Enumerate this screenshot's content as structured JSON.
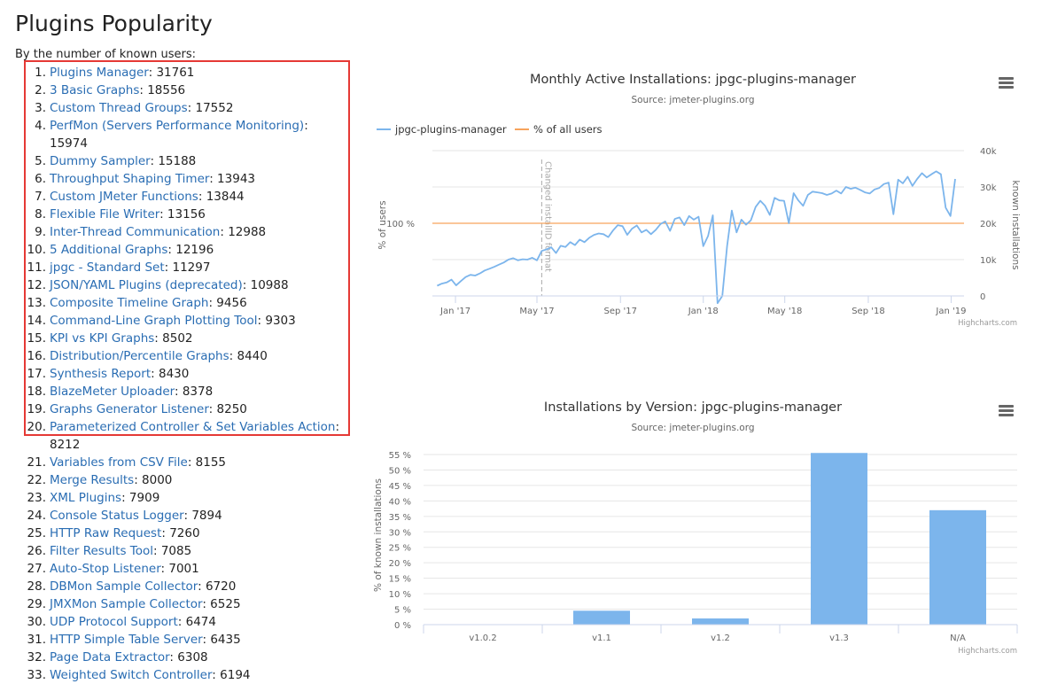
{
  "page": {
    "title": "Plugins Popularity",
    "subtitle": "By the number of known users:"
  },
  "plugins": [
    {
      "rank": "1.",
      "name": "Plugins Manager",
      "users": "31761"
    },
    {
      "rank": "2.",
      "name": "3 Basic Graphs",
      "users": "18556"
    },
    {
      "rank": "3.",
      "name": "Custom Thread Groups",
      "users": "17552"
    },
    {
      "rank": "4.",
      "name": "PerfMon (Servers Performance Monitoring)",
      "users": "15974"
    },
    {
      "rank": "5.",
      "name": "Dummy Sampler",
      "users": "15188"
    },
    {
      "rank": "6.",
      "name": "Throughput Shaping Timer",
      "users": "13943"
    },
    {
      "rank": "7.",
      "name": "Custom JMeter Functions",
      "users": "13844"
    },
    {
      "rank": "8.",
      "name": "Flexible File Writer",
      "users": "13156"
    },
    {
      "rank": "9.",
      "name": "Inter-Thread Communication",
      "users": "12988"
    },
    {
      "rank": "10.",
      "name": "5 Additional Graphs",
      "users": "12196"
    },
    {
      "rank": "11.",
      "name": "jpgc - Standard Set",
      "users": "11297"
    },
    {
      "rank": "12.",
      "name": "JSON/YAML Plugins (deprecated)",
      "users": "10988"
    },
    {
      "rank": "13.",
      "name": "Composite Timeline Graph",
      "users": "9456"
    },
    {
      "rank": "14.",
      "name": "Command-Line Graph Plotting Tool",
      "users": "9303"
    },
    {
      "rank": "15.",
      "name": "KPI vs KPI Graphs",
      "users": "8502"
    },
    {
      "rank": "16.",
      "name": "Distribution/Percentile Graphs",
      "users": "8440"
    },
    {
      "rank": "17.",
      "name": "Synthesis Report",
      "users": "8430"
    },
    {
      "rank": "18.",
      "name": "BlazeMeter Uploader",
      "users": "8378"
    },
    {
      "rank": "19.",
      "name": "Graphs Generator Listener",
      "users": "8250"
    },
    {
      "rank": "20.",
      "name": "Parameterized Controller & Set Variables Action",
      "users": "8212"
    },
    {
      "rank": "21.",
      "name": "Variables from CSV File",
      "users": "8155"
    },
    {
      "rank": "22.",
      "name": "Merge Results",
      "users": "8000"
    },
    {
      "rank": "23.",
      "name": "XML Plugins",
      "users": "7909"
    },
    {
      "rank": "24.",
      "name": "Console Status Logger",
      "users": "7894"
    },
    {
      "rank": "25.",
      "name": "HTTP Raw Request",
      "users": "7260"
    },
    {
      "rank": "26.",
      "name": "Filter Results Tool",
      "users": "7085"
    },
    {
      "rank": "27.",
      "name": "Auto-Stop Listener",
      "users": "7001"
    },
    {
      "rank": "28.",
      "name": "DBMon Sample Collector",
      "users": "6720"
    },
    {
      "rank": "29.",
      "name": "JMXMon Sample Collector",
      "users": "6525"
    },
    {
      "rank": "30.",
      "name": "UDP Protocol Support",
      "users": "6474"
    },
    {
      "rank": "31.",
      "name": "HTTP Simple Table Server",
      "users": "6435"
    },
    {
      "rank": "32.",
      "name": "Page Data Extractor",
      "users": "6308"
    },
    {
      "rank": "33.",
      "name": "Weighted Switch Controller",
      "users": "6194"
    }
  ],
  "chart_data": [
    {
      "type": "line",
      "title": "Monthly Active Installations: jpgc-plugins-manager",
      "subtitle": "Source: jmeter-plugins.org",
      "credits": "Highcharts.com",
      "legend_position": "top-left",
      "x_tick_labels": [
        "Jan '17",
        "May '17",
        "Sep '17",
        "Jan '18",
        "May '18",
        "Sep '18",
        "Jan '19"
      ],
      "xlim": [
        "2016-11-28",
        "2019-01-20"
      ],
      "y_left_label": "% of users",
      "y_left_tick_labels": [
        "100 %"
      ],
      "y_right_label": "known installations",
      "y_right_tick_labels": [
        "0",
        "10k",
        "20k",
        "30k",
        "40k"
      ],
      "y_right_lim": [
        0,
        40000
      ],
      "grid": true,
      "plot_line": {
        "date": "2017-05-08",
        "label": "Changed installID format"
      },
      "series": [
        {
          "name": "jpgc-plugins-manager",
          "color": "#7cb5ec",
          "axis": "right",
          "x": [
            "2016-12-05",
            "2016-12-12",
            "2016-12-19",
            "2016-12-26",
            "2017-01-02",
            "2017-01-09",
            "2017-01-16",
            "2017-01-23",
            "2017-01-30",
            "2017-02-06",
            "2017-02-13",
            "2017-02-20",
            "2017-02-27",
            "2017-03-06",
            "2017-03-13",
            "2017-03-20",
            "2017-03-27",
            "2017-04-03",
            "2017-04-10",
            "2017-04-17",
            "2017-04-24",
            "2017-05-01",
            "2017-05-08",
            "2017-05-15",
            "2017-05-22",
            "2017-05-29",
            "2017-06-05",
            "2017-06-12",
            "2017-06-19",
            "2017-06-26",
            "2017-07-03",
            "2017-07-10",
            "2017-07-17",
            "2017-07-24",
            "2017-07-31",
            "2017-08-07",
            "2017-08-14",
            "2017-08-21",
            "2017-08-28",
            "2017-09-04",
            "2017-09-11",
            "2017-09-18",
            "2017-09-25",
            "2017-10-02",
            "2017-10-09",
            "2017-10-16",
            "2017-10-23",
            "2017-10-30",
            "2017-11-06",
            "2017-11-13",
            "2017-11-20",
            "2017-11-27",
            "2017-12-04",
            "2017-12-11",
            "2017-12-18",
            "2017-12-25",
            "2018-01-01",
            "2018-01-08",
            "2018-01-15",
            "2018-01-22",
            "2018-01-29",
            "2018-02-05",
            "2018-02-12",
            "2018-02-19",
            "2018-02-26",
            "2018-03-05",
            "2018-03-12",
            "2018-03-19",
            "2018-03-26",
            "2018-04-02",
            "2018-04-09",
            "2018-04-16",
            "2018-04-23",
            "2018-04-30",
            "2018-05-07",
            "2018-05-14",
            "2018-05-21",
            "2018-05-28",
            "2018-06-04",
            "2018-06-11",
            "2018-06-18",
            "2018-06-25",
            "2018-07-02",
            "2018-07-09",
            "2018-07-16",
            "2018-07-23",
            "2018-07-30",
            "2018-08-06",
            "2018-08-13",
            "2018-08-20",
            "2018-08-27",
            "2018-09-03",
            "2018-09-10",
            "2018-09-17",
            "2018-09-24",
            "2018-10-01",
            "2018-10-08",
            "2018-10-15",
            "2018-10-22",
            "2018-10-29",
            "2018-11-05",
            "2018-11-12",
            "2018-11-19",
            "2018-11-26",
            "2018-12-03",
            "2018-12-10",
            "2018-12-17",
            "2018-12-24",
            "2018-12-31",
            "2019-01-07"
          ],
          "values": [
            2800,
            3400,
            3700,
            4500,
            2900,
            4100,
            5200,
            5800,
            5600,
            6200,
            7000,
            7500,
            8000,
            8600,
            9200,
            10000,
            10400,
            9800,
            10100,
            10000,
            10500,
            9800,
            12400,
            12800,
            13400,
            11800,
            13800,
            13500,
            14800,
            14000,
            15500,
            14800,
            16000,
            16800,
            17200,
            17000,
            16200,
            18000,
            19500,
            19200,
            16800,
            18500,
            19400,
            17500,
            18200,
            17000,
            18200,
            19800,
            20500,
            17900,
            21200,
            21600,
            19500,
            22000,
            21000,
            21800,
            13700,
            16500,
            22200,
            -2000,
            0,
            13700,
            23500,
            17500,
            21000,
            19600,
            20800,
            24500,
            26200,
            24800,
            22300,
            27000,
            26300,
            26200,
            20000,
            28300,
            26300,
            24800,
            27800,
            28700,
            28500,
            28300,
            27800,
            28200,
            29000,
            28200,
            30000,
            29500,
            29800,
            29200,
            28500,
            28200,
            29300,
            29700,
            30800,
            31200,
            22500,
            32000,
            31000,
            32800,
            30300,
            32200,
            33800,
            32600,
            33500,
            34300,
            33500,
            24300,
            22000,
            32200
          ]
        },
        {
          "name": "% of all users",
          "color": "#f7a35c",
          "axis": "left",
          "constant": "100 %"
        }
      ]
    },
    {
      "type": "bar",
      "title": "Installations by Version: jpgc-plugins-manager",
      "subtitle": "Source: jmeter-plugins.org",
      "credits": "Highcharts.com",
      "ylabel": "% of known installations",
      "ylim": [
        0,
        55
      ],
      "y_ticks": [
        0,
        5,
        10,
        15,
        20,
        25,
        30,
        35,
        40,
        45,
        50,
        55
      ],
      "y_tick_suffix": " %",
      "grid": true,
      "categories": [
        "v1.0.2",
        "v1.1",
        "v1.2",
        "v1.3",
        "N/A"
      ],
      "values": [
        0,
        4.5,
        2.0,
        55.5,
        37.0
      ],
      "color": "#7cb5ec"
    }
  ]
}
